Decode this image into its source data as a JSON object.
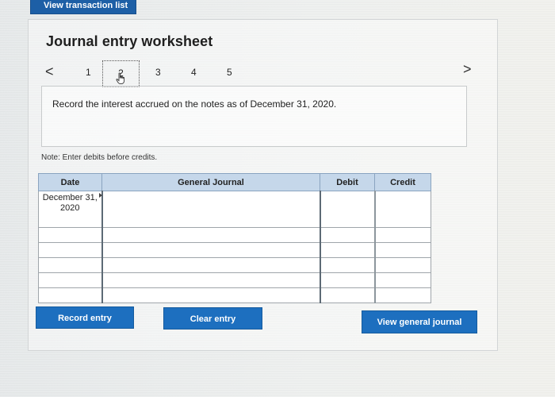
{
  "header": {
    "transaction_list_button": "View transaction list"
  },
  "worksheet": {
    "title": "Journal entry worksheet",
    "pager": {
      "prev": "<",
      "next": ">",
      "pages": [
        "1",
        "2",
        "3",
        "4",
        "5"
      ],
      "current": "2"
    },
    "instruction": "Record the interest accrued on the notes as of December 31, 2020.",
    "note": "Note: Enter debits before credits."
  },
  "table": {
    "columns": [
      "Date",
      "General Journal",
      "Debit",
      "Credit"
    ],
    "rows": [
      {
        "date": "December 31, 2020",
        "account": "",
        "debit": "",
        "credit": ""
      },
      {
        "date": "",
        "account": "",
        "debit": "",
        "credit": ""
      },
      {
        "date": "",
        "account": "",
        "debit": "",
        "credit": ""
      },
      {
        "date": "",
        "account": "",
        "debit": "",
        "credit": ""
      },
      {
        "date": "",
        "account": "",
        "debit": "",
        "credit": ""
      },
      {
        "date": "",
        "account": "",
        "debit": "",
        "credit": ""
      }
    ]
  },
  "buttons": {
    "record_entry": "Record entry",
    "clear_entry": "Clear entry",
    "view_general_journal": "View general journal"
  },
  "colors": {
    "button_blue": "#1d6fbf",
    "header_blue": "#c5d7ea"
  },
  "icons": {
    "current_page_cursor": "hand-pointer-icon"
  }
}
